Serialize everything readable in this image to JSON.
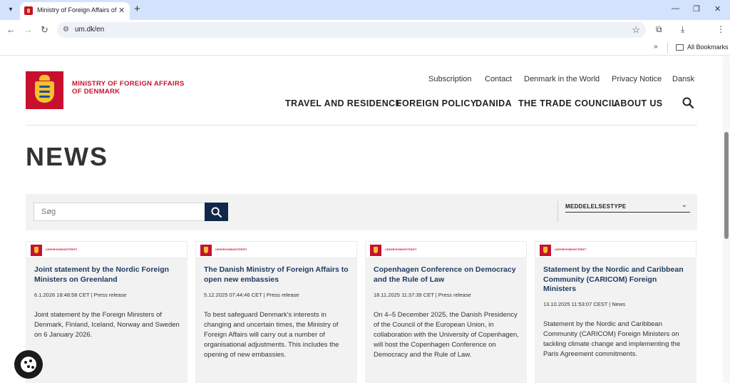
{
  "browser": {
    "tab_title": "Ministry of Foreign Affairs of Denmark",
    "tab_menu_icon": "▾",
    "close_icon": "✕",
    "new_tab_icon": "+",
    "url": "um.dk/en",
    "back_icon": "←",
    "forward_icon": "→",
    "reload_icon": "↻",
    "star_icon": "☆",
    "more_icon": "⋮",
    "download_icon": "⤓",
    "extensions_icon": "⧉",
    "minimize_icon": "—",
    "restore_icon": "❐",
    "window_close_icon": "✕",
    "bookmarks_more": "»",
    "all_bookmarks": "All Bookmarks"
  },
  "site": {
    "logo_line1": "MINISTRY OF FOREIGN AFFAIRS",
    "logo_line2": "OF DENMARK",
    "utility_links": [
      "Subscription",
      "Contact",
      "Denmark in the World",
      "Privacy Notice",
      "Dansk"
    ],
    "main_nav": [
      "TRAVEL AND RESIDENCE",
      "FOREIGN POLICY",
      "DANIDA",
      "THE TRADE COUNCIL",
      "ABOUT US"
    ],
    "brand_red": "#c8102e",
    "brand_navy": "#10284a"
  },
  "news": {
    "heading": "NEWS",
    "search_placeholder": "Søg",
    "filter_label": "MEDDELELSESTYPE",
    "filter_chevron": "⌄",
    "card_org_label": "UDENRIGSMINISTERIET",
    "cards": [
      {
        "title": "Joint statement by the Nordic Foreign Ministers on Greenland",
        "meta": "6.1.2026 18:48:58 CET | Press release",
        "body": "Joint statement by the Foreign Ministers of Denmark, Finland, Iceland, Norway and Sweden on 6 January 2026."
      },
      {
        "title": "The Danish Ministry of Foreign Affairs to open new embassies",
        "meta": "5.12.2025 07:44:46 CET | Press release",
        "body": "To best safeguard Denmark's interests in changing and uncertain times, the Ministry of Foreign Affairs will carry out a number of organisational adjustments. This includes the opening of new embassies."
      },
      {
        "title": "Copenhagen Conference on Democracy and the Rule of Law",
        "meta": "18.11.2025 11:37:39 CET | Press release",
        "body": "On 4–5 December 2025, the Danish Presidency of the Council of the European Union, in collaboration with the University of Copenhagen, will host the Copenhagen Conference on Democracy and the Rule of Law."
      },
      {
        "title": "Statement by the Nordic and Caribbean Community (CARICOM) Foreign Ministers",
        "meta": "13.10.2025 11:53:07 CEST | News",
        "body": "Statement by the Nordic and Caribbean Community (CARICOM) Foreign Ministers on tackling climate change and implementing the Paris Agreement commitments."
      }
    ]
  }
}
